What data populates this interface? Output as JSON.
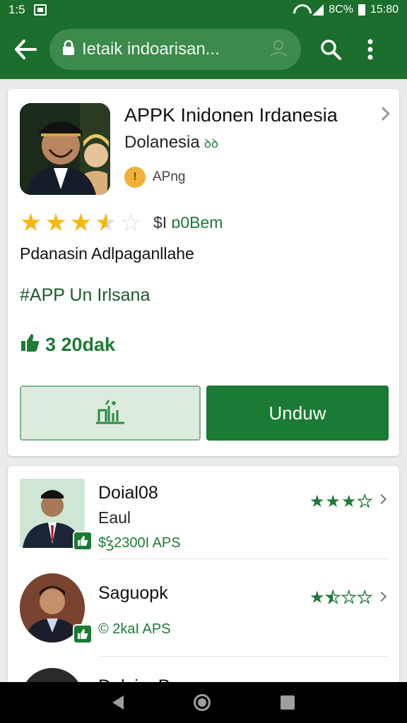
{
  "status": {
    "time": "1:5",
    "battery_percent": "8С%",
    "clock": "15:80"
  },
  "toolbar": {
    "search_text": "Ietaik indoarisan...",
    "icons": [
      "back-arrow-icon",
      "lock-icon",
      "profile-icon",
      "search-icon",
      "more-vert-icon"
    ]
  },
  "app": {
    "title": "APPK Inidonen Irdanesia",
    "developer": "Dolanesia",
    "developer_badge": "ꝺꝺ",
    "badge_label": "APng",
    "rating_stars": 3.5,
    "price_prefix": "$I",
    "price_value": "ɒ0Bem",
    "tagline": "Pdanasin Adlpaganllahe",
    "hashtag": "#APP Un Irlsana",
    "downloads": "3 20dak",
    "primary_button": "Unduw",
    "accent_color": "#1b7a34",
    "toolbar_color": "#1b6e2c"
  },
  "list": {
    "items": [
      {
        "title": "Doial08",
        "subtitle": "Eaul",
        "price": "$Ꝣ2300I APS",
        "rating_stars": 3
      },
      {
        "title": "Saguopk",
        "subtitle": "",
        "price": "© 2kaI APS",
        "rating_stars": 1.5
      }
    ],
    "partial_title": "Dalai:.. P"
  }
}
